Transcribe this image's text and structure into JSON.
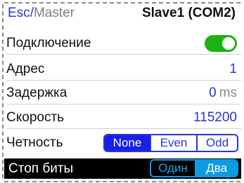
{
  "header": {
    "esc_label": "Esc",
    "separator": "/",
    "master_label": "Master",
    "title": "Slave1 (COM2)"
  },
  "settings": {
    "connection": {
      "label": "Подключение",
      "enabled": true
    },
    "address": {
      "label": "Адрес",
      "value": "1"
    },
    "delay": {
      "label": "Задержка",
      "value": "0",
      "unit": "ms"
    },
    "speed": {
      "label": "Скорость",
      "value": "115200"
    },
    "parity": {
      "label": "Четность",
      "options": [
        "None",
        "Even",
        "Odd"
      ],
      "selected": "None"
    },
    "stop_bits": {
      "label": "Стоп биты",
      "options": [
        "Один",
        "Два"
      ],
      "selected": "Два"
    }
  },
  "colors": {
    "accent": "#2637d6",
    "toggle_on": "#1cb414",
    "selected_row_bg": "#000000",
    "dark_segment": "#0f9be0"
  }
}
